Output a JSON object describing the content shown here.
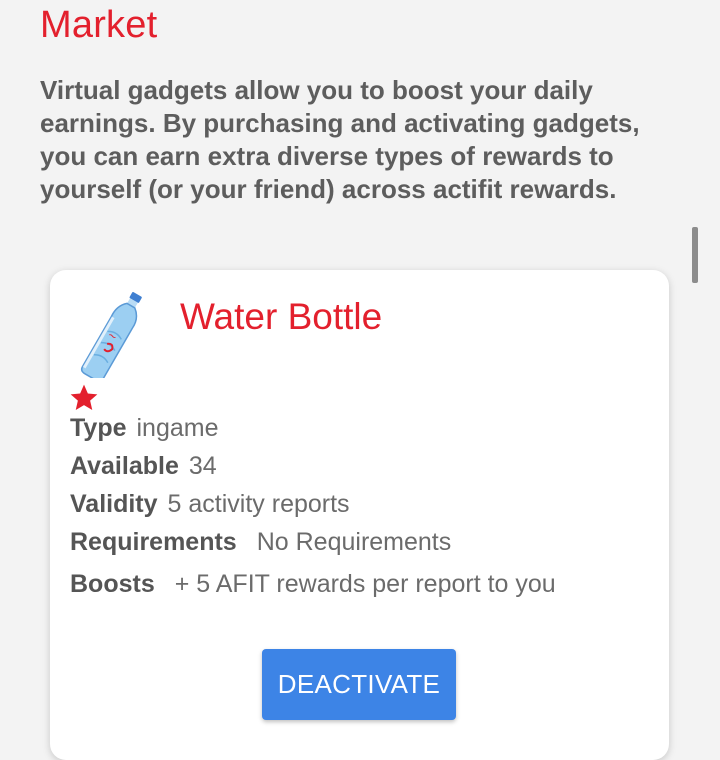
{
  "page": {
    "title": "Market",
    "intro": "Virtual gadgets allow you to boost your daily earnings. By purchasing and activating gadgets, you can earn extra diverse types of rewards to yourself (or your friend) across actifit rewards."
  },
  "gadget": {
    "name": "Water Bottle",
    "icon": "water-bottle-icon",
    "badge_icon": "star-icon",
    "accent_color": "#e3202d",
    "details": [
      {
        "label": "Type",
        "value": "ingame"
      },
      {
        "label": "Available",
        "value": "34"
      },
      {
        "label": "Validity",
        "value": "5 activity reports"
      },
      {
        "label": "Requirements",
        "value": "No Requirements"
      },
      {
        "label": "Boosts",
        "value": "+ 5 AFIT rewards per report to you"
      }
    ],
    "action_label": "DEACTIVATE",
    "action_color": "#3d84e6"
  }
}
